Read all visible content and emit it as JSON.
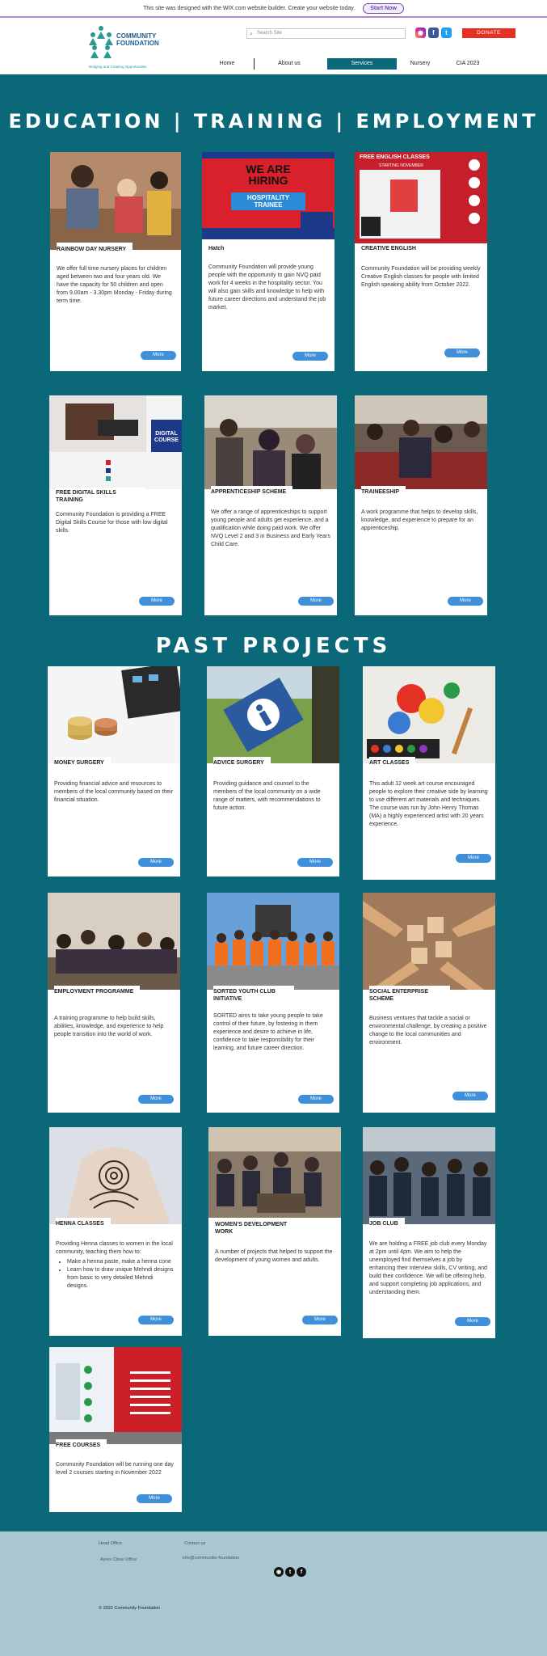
{
  "wix_banner": {
    "text": "This site was designed with the WIX.com website builder. Create your website today.",
    "button": "Start Now"
  },
  "header": {
    "logo_line1": "COMMUNITY",
    "logo_line2": "FOUNDATION",
    "tagline": "Bridging and Creating Opportunities",
    "search_placeholder": "Search Site",
    "donate": "DONATE",
    "nav": [
      "Home",
      "About us",
      "Services",
      "Nursery",
      "CIA 2023"
    ],
    "nav_active": "Services"
  },
  "titles": {
    "education": "EDUCATION | TRAINING | EMPLOYMENT",
    "past": "PAST PROJECTS"
  },
  "more_label": "More",
  "cards": [
    {
      "title": "RAINBOW DAY NURSERY",
      "text": "We offer full time nursery places for children aged between two and four years old. We have the capacity for 50 children and open from 9.00am - 3.30pm Monday - Friday during term time."
    },
    {
      "title": "Hatch",
      "text": "Community Foundation will provide young people with the opportunity to gain NVQ paid work for 4 weeks in the hospitality sector. You will also gain skills and knowledge to help with future career directions and understand the job market.",
      "poster": {
        "line1": "WE ARE",
        "line2": "HIRING",
        "line3": "HOSPITALITY",
        "line4": "TRAINEE"
      }
    },
    {
      "title": "CREATIVE ENGLISH",
      "text": "Community Foundation will be providing weekly Creative English classes for people with limited English speaking ability from October 2022.",
      "poster": {
        "line1": "FREE ENGLISH CLASSES",
        "line2": "STARTING NOVEMBER"
      }
    },
    {
      "title": "FREE DIGITAL SKILLS TRAINING",
      "text": "Community Foundation is providing a FREE Digital Skills Course for those with low digital skills.",
      "poster": {
        "line1": "DIGITAL",
        "line2": "COURSE"
      }
    },
    {
      "title": "APPRENTICESHIP SCHEME",
      "text": "We offer a range of apprenticeships to support young people and adults get experience, and a qualification while doing paid work. We offer NVQ Level 2 and 3 in Business and Early Years Child Care."
    },
    {
      "title": "TRAINEESHIP",
      "text": "A work programme that helps to develop skills, knowledge, and experience to prepare for an apprenticeship."
    },
    {
      "title": "MONEY SURGERY",
      "text": "Providing financial advice and resources to members of the local community based on their financial situation."
    },
    {
      "title": "ADVICE SURGERY",
      "text": "Providing guidance and counsel to the members of the local community on a wide range of matters, with recommendations to future action."
    },
    {
      "title": "ART CLASSES",
      "text": "This adult 12 week art course encouraged people to explore their creative side by learning to use different art materials and techniques. The course was run by John Henry Thomas (MA) a highly experienced artist with 20 years experience."
    },
    {
      "title": "EMPLOYMENT PROGRAMME",
      "text": "A training programme to help build skills, abilities, knowledge, and experience to help people transition into the world of work."
    },
    {
      "title": "SORTED YOUTH CLUB INITIATIVE",
      "text": "SORTED aims to take young people to take control of their future, by fostering in them experience and desire to achieve in life, confidence to take responsibility for their learning, and future career direction."
    },
    {
      "title": "SOCIAL ENTERPRISE SCHEME",
      "text": "Business ventures that tackle a social or environmental challenge, by creating a positive change to the local communities and environment."
    },
    {
      "title": "HENNA CLASSES",
      "text": "Providing Henna classes to women in the local community, teaching them how to:",
      "bullets": [
        "Make a henna paste, make a henna cone",
        "Learn how to draw unique Mehndi designs from basic to very detailed Mehndi designs."
      ]
    },
    {
      "title": "WOMEN'S DEVELOPMENT WORK",
      "text": "A number of projects that helped to support the development of young women and adults."
    },
    {
      "title": "JOB CLUB",
      "text": "We are holding a FREE job club every Monday at 2pm until 4pm. We aim to help the unemployed find themselves a job by enhancing their interview skills, CV writing, and build their confidence. We will be offering help, and support completing job applications, and understanding them."
    },
    {
      "title": "FREE COURSES",
      "text": "Community Foundation will be running one day level 2 courses starting in November 2022"
    }
  ],
  "footer": {
    "col1_title": "Head Office",
    "col1_line": "Ayres Close Office",
    "col2_title": "Contact us",
    "col2_line": "info@communitie-foundation",
    "copyright": "© 2022 Community Foundation"
  },
  "colors": {
    "background": "#0b6879",
    "accent_button": "#3f8fda",
    "donate": "#e53024",
    "footer": "#a8c7d2"
  }
}
